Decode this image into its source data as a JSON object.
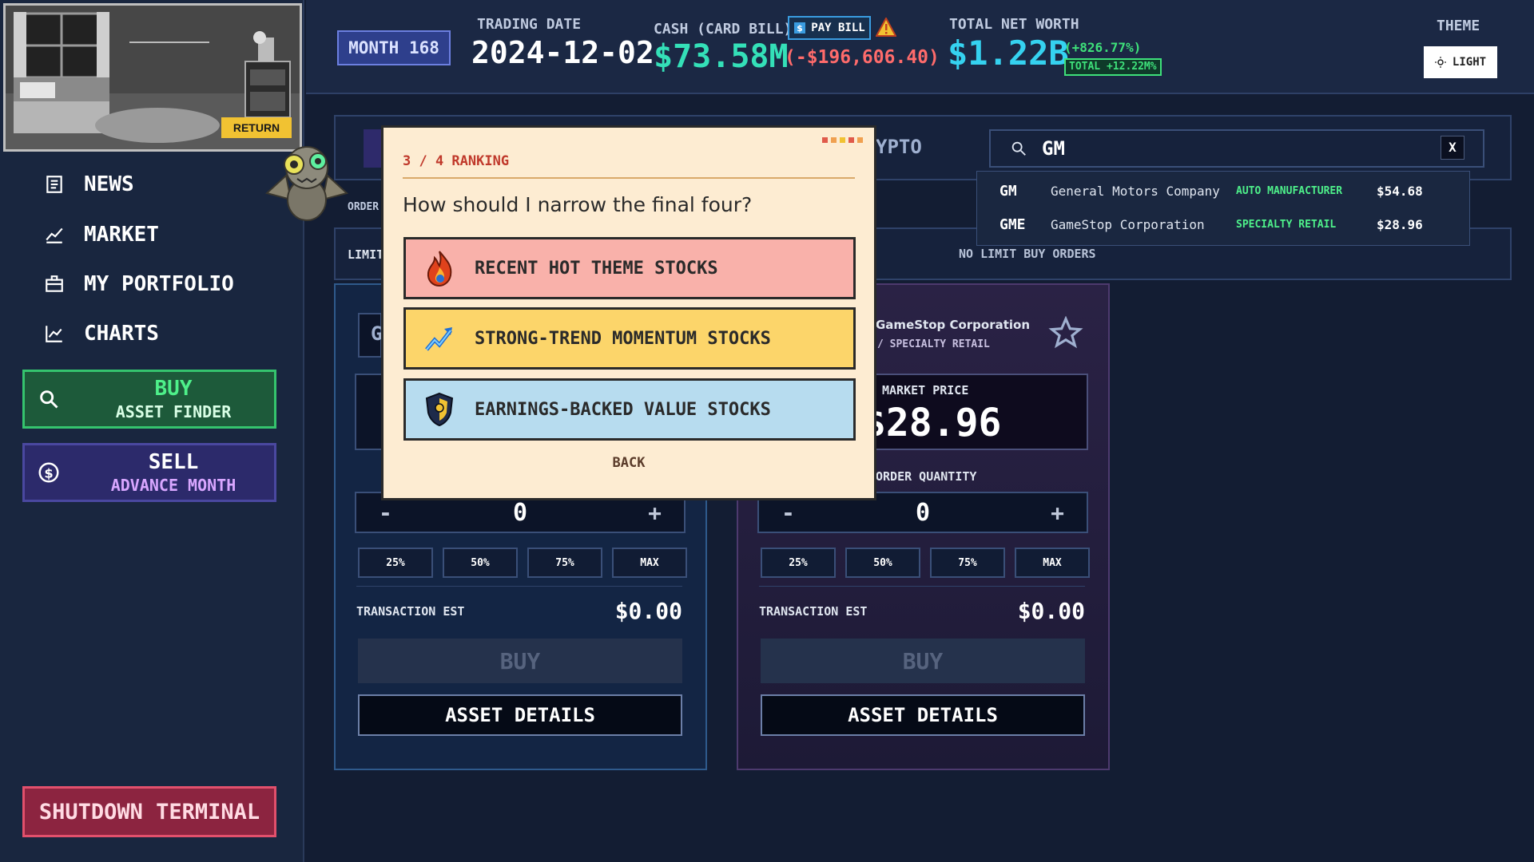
{
  "room": {
    "return_label": "RETURN"
  },
  "nav": {
    "items": [
      {
        "label": "NEWS",
        "icon": "news-icon"
      },
      {
        "label": "MARKET",
        "icon": "market-icon"
      },
      {
        "label": "MY PORTFOLIO",
        "icon": "briefcase-icon"
      },
      {
        "label": "CHARTS",
        "icon": "chart-line-icon"
      }
    ]
  },
  "buy_button": {
    "title": "BUY",
    "subtitle": "ASSET FINDER"
  },
  "sell_button": {
    "title": "SELL",
    "subtitle": "ADVANCE MONTH"
  },
  "shutdown_label": "SHUTDOWN TERMINAL",
  "header": {
    "month": "MONTH 168",
    "trading_date_label": "TRADING DATE",
    "trading_date": "2024-12-02",
    "cash_label": "CASH (CARD BILL)",
    "pay_bill": "PAY BILL",
    "cash_value": "$73.58M",
    "card_bill": "(-$196,606.40)",
    "net_worth_label": "TOTAL NET WORTH",
    "net_worth": "$1.22B",
    "net_worth_change": "(+826.77%)",
    "total_badge": "TOTAL +12.22M%",
    "theme_label": "THEME",
    "theme_button": "LIGHT"
  },
  "tabs": {
    "crypto_partial": "YPTO",
    "order_partial": "ORDER"
  },
  "limit": {
    "partial_label": "LIMIT",
    "no_orders": "NO LIMIT BUY ORDERS"
  },
  "search": {
    "query": "GM",
    "clear": "X",
    "results": [
      {
        "ticker": "GM",
        "name": "General Motors Company",
        "sector": "AUTO MANUFACTURER",
        "price": "$54.68"
      },
      {
        "ticker": "GME",
        "name": "GameStop Corporation",
        "sector": "SPECIALTY RETAIL",
        "price": "$28.96"
      }
    ]
  },
  "card_left": {
    "partial_ticker": "G",
    "quantity": "0",
    "pct": [
      "25%",
      "50%",
      "75%",
      "MAX"
    ],
    "tx_label": "TRANSACTION EST",
    "tx_value": "$0.00",
    "buy": "BUY",
    "details": "ASSET DETAILS"
  },
  "card_right": {
    "name": "GameStop Corporation",
    "sector": "/ SPECIALTY RETAIL",
    "market_price_label": "MARKET PRICE",
    "market_price": "$28.96",
    "order_qty_label": "ORDER QUANTITY",
    "quantity": "0",
    "pct": [
      "25%",
      "50%",
      "75%",
      "MAX"
    ],
    "tx_label": "TRANSACTION EST",
    "tx_value": "$0.00",
    "buy": "BUY",
    "details": "ASSET DETAILS"
  },
  "modal": {
    "step": "3 / 4  RANKING",
    "question": "How should I narrow the final four?",
    "options": [
      {
        "label": "RECENT HOT THEME STOCKS",
        "icon": "flame-icon"
      },
      {
        "label": "STRONG-TREND MOMENTUM STOCKS",
        "icon": "trend-up-icon"
      },
      {
        "label": "EARNINGS-BACKED VALUE STOCKS",
        "icon": "shield-icon"
      }
    ],
    "back": "BACK"
  },
  "colors": {
    "buy_green": "#35c46e",
    "sell_purple": "#4a48a0",
    "cash_teal": "#34e0b8",
    "net_worth_cyan": "#35d2f0",
    "negative_red": "#ff6b6b",
    "modal_bg": "#fdecd2"
  }
}
